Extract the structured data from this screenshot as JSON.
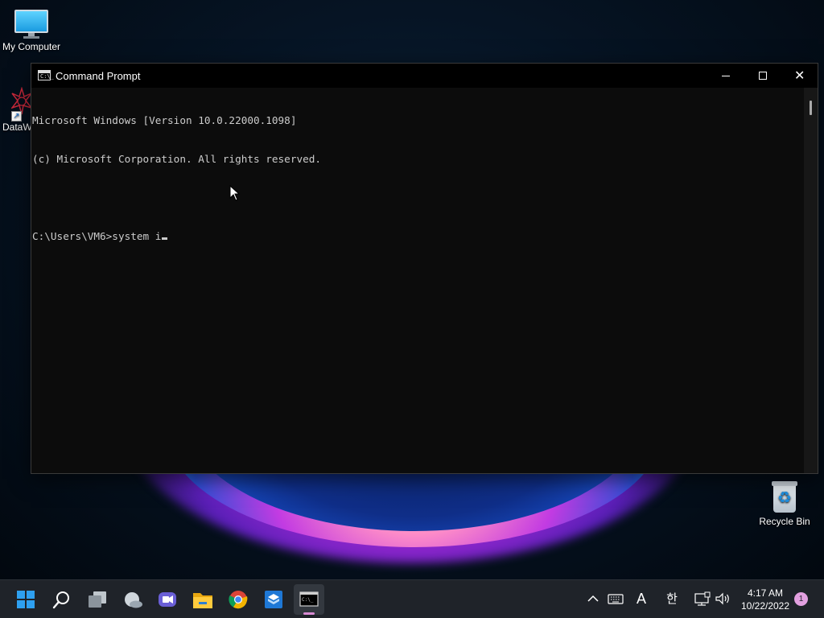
{
  "desktop": {
    "icons": [
      {
        "label": "My Computer",
        "icon": "monitor-icon"
      },
      {
        "label": "DataW",
        "icon": "datawrapper-icon"
      },
      {
        "label": "Recycle Bin",
        "icon": "recycle-bin-icon"
      }
    ]
  },
  "window": {
    "title": "Command Prompt",
    "app_icon_text": "C:\\_",
    "controls": {
      "minimize": "minimize",
      "maximize": "maximize",
      "close": "close"
    },
    "console": {
      "lines": [
        "Microsoft Windows [Version 10.0.22000.1098]",
        "(c) Microsoft Corporation. All rights reserved.",
        "",
        "C:\\Users\\VM6>system i"
      ]
    },
    "colors": {
      "background": "#0c0c0c",
      "text": "#cccccc",
      "titlebar": "#000000"
    }
  },
  "taskbar": {
    "apps": [
      {
        "name": "Start",
        "icon": "windows-start-icon"
      },
      {
        "name": "Search",
        "icon": "search-icon"
      },
      {
        "name": "Task View",
        "icon": "task-view-icon"
      },
      {
        "name": "Widgets",
        "icon": "widgets-weather-icon"
      },
      {
        "name": "Teams Chat",
        "icon": "chat-icon"
      },
      {
        "name": "File Explorer",
        "icon": "folder-icon"
      },
      {
        "name": "Google Chrome",
        "icon": "chrome-icon"
      },
      {
        "name": "Sandbox",
        "icon": "sandbox-icon"
      },
      {
        "name": "Command Prompt",
        "icon": "terminal-icon",
        "active": true
      }
    ],
    "tray": {
      "chevron": "^",
      "keyboard": "keyboard-icon",
      "input_mode": "A",
      "ime": "한",
      "network": "network-icon",
      "volume": "volume-icon",
      "time": "4:17 AM",
      "date": "10/22/2022",
      "notification_count": "1"
    },
    "colors": {
      "background": "#1f2329",
      "active_indicator": "#d98bd3"
    }
  }
}
